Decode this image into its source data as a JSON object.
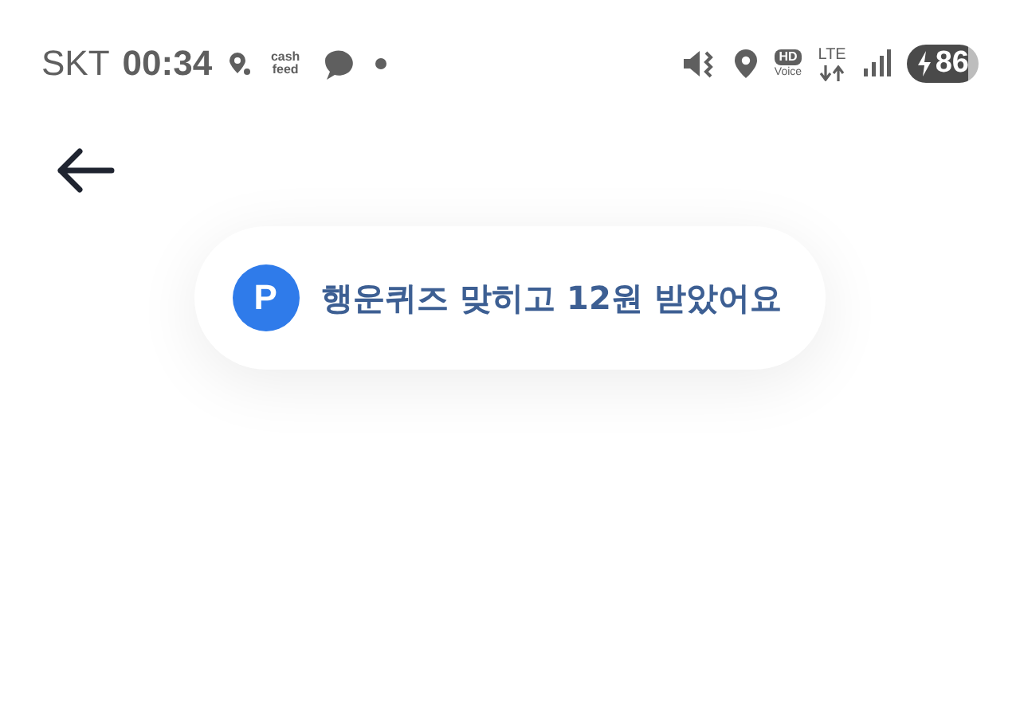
{
  "status_bar": {
    "carrier": "SKT",
    "time": "00:34",
    "app_logo": "cash feed",
    "hd_badge": "HD",
    "hd_caption": "Voice",
    "network": "LTE",
    "battery": "86"
  },
  "toast": {
    "badge": "P",
    "message": "행운퀴즈 맞히고 12원 받았어요"
  }
}
